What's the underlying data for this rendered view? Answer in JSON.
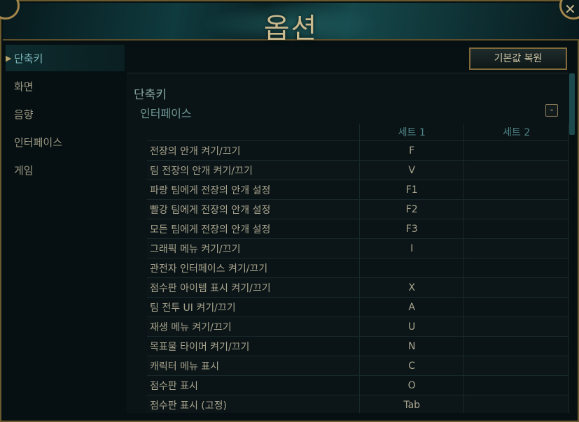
{
  "window": {
    "title": "옵션",
    "close_label": "✕"
  },
  "sidebar": {
    "items": [
      {
        "label": "단축키",
        "active": true
      },
      {
        "label": "화면"
      },
      {
        "label": "음향"
      },
      {
        "label": "인터페이스"
      },
      {
        "label": "게임"
      }
    ]
  },
  "toolbar": {
    "restore_defaults_label": "기본값 복원"
  },
  "section": {
    "title": "단축키",
    "group_title": "인터페이스",
    "collapse_label": "-"
  },
  "table": {
    "headers": [
      "",
      "세트 1",
      "세트 2"
    ],
    "rows": [
      {
        "action": "전장의 안개 켜기/끄기",
        "set1": "F",
        "set2": ""
      },
      {
        "action": "팀 전장의 안개 켜기/끄기",
        "set1": "V",
        "set2": ""
      },
      {
        "action": "파랑 팀에게 전장의 안개 설정",
        "set1": "F1",
        "set2": ""
      },
      {
        "action": "빨강 팀에게 전장의 안개 설정",
        "set1": "F2",
        "set2": ""
      },
      {
        "action": "모든 팀에게 전장의 안개 설정",
        "set1": "F3",
        "set2": ""
      },
      {
        "action": "그래픽 메뉴 켜기/끄기",
        "set1": "I",
        "set2": ""
      },
      {
        "action": "관전자 인터페이스 켜기/끄기",
        "set1": "",
        "set2": ""
      },
      {
        "action": "점수판 아이템 표시 켜기/끄기",
        "set1": "X",
        "set2": ""
      },
      {
        "action": "팀 전투 UI 켜기/끄기",
        "set1": "A",
        "set2": ""
      },
      {
        "action": "재생 메뉴 켜기/끄기",
        "set1": "U",
        "set2": ""
      },
      {
        "action": "목표물 타이머 켜기/끄기",
        "set1": "N",
        "set2": ""
      },
      {
        "action": "캐릭터 메뉴 표시",
        "set1": "C",
        "set2": ""
      },
      {
        "action": "점수판 표시",
        "set1": "O",
        "set2": ""
      },
      {
        "action": "점수판 표시 (고정)",
        "set1": "Tab",
        "set2": ""
      }
    ]
  }
}
